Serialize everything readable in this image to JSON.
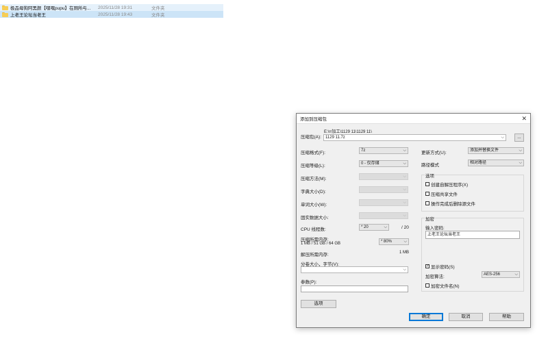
{
  "files": [
    {
      "name": "极品母狗阿黑颜【嘿嘿pupu】在厕所与...",
      "date": "2025/11/28 19:31",
      "type": "文件夹",
      "icon": "folder-icon"
    },
    {
      "name": "上老王论坛当老王",
      "date": "2025/11/28 19:43",
      "type": "文件夹",
      "icon": "folder-icon"
    }
  ],
  "dialog": {
    "title": "添加到压缩包",
    "close": "✕",
    "archive_label": "压缩包(A):",
    "archive_path": "E:\\rr加工\\1129 11\\1129 11\\",
    "archive_name": "1129 11.7z",
    "browse": "...",
    "format_label": "压缩格式(F):",
    "format_value": "7z",
    "level_label": "压缩等级(L):",
    "level_value": "0 - 仅存储",
    "method_label": "压缩方法(M):",
    "dict_label": "字典大小(D):",
    "word_label": "单词大小(W):",
    "solid_label": "固实数据大小:",
    "cpu_label": "CPU 线程数:",
    "cpu_value": "* 20",
    "cpu_max": "/ 20",
    "mem_label": "压缩所需内存:",
    "mem_detail": "1 MB / 51 GB / 64 GB",
    "mem_value": "* 80%",
    "decomp_label": "解压所需内存:",
    "decomp_value": "1 MB",
    "split_label": "分卷大小，字节(V):",
    "split_value": "",
    "params_label": "参数(P):",
    "params_value": "",
    "options_button": "选项",
    "update_label": "更新方式(U):",
    "update_value": "添加并替换文件",
    "path_label": "路径模式",
    "path_value": "相对路径",
    "options_group": "选项",
    "opt_sfx": "创建自解压程序(X)",
    "opt_shared": "压缩共享文件",
    "opt_delete": "操作完成后删除源文件",
    "enc_group": "加密",
    "pwd_label": "输入密码:",
    "pwd_value": "上老王论坛当老王",
    "show_pwd": "显示密码(S)",
    "show_pwd_check": "✓",
    "enc_method_label": "加密算法:",
    "enc_method_value": "AES-256",
    "enc_names": "加密文件名(N)",
    "ok": "确定",
    "cancel": "取消",
    "help": "帮助"
  }
}
